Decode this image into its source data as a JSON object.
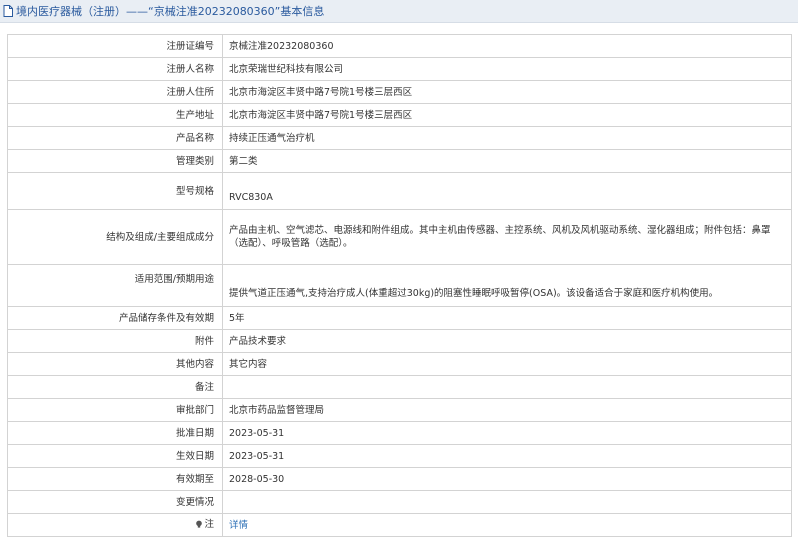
{
  "title": "境内医疗器械（注册）——“京械注准20232080360”基本信息",
  "accent_color": "#2a5a9e",
  "link_color": "#2b6fb6",
  "rows": [
    {
      "label": "注册证编号",
      "value": "京械注准20232080360"
    },
    {
      "label": "注册人名称",
      "value": "北京荣瑞世纪科技有限公司"
    },
    {
      "label": "注册人住所",
      "value": "北京市海淀区丰贤中路7号院1号楼三层西区"
    },
    {
      "label": "生产地址",
      "value": "北京市海淀区丰贤中路7号院1号楼三层西区"
    },
    {
      "label": "产品名称",
      "value": "持续正压通气治疗机"
    },
    {
      "label": "管理类别",
      "value": "第二类"
    },
    {
      "label": "型号规格",
      "value": "RVC830A"
    },
    {
      "label": "结构及组成/主要组成成分",
      "value": "产品由主机、空气滤芯、电源线和附件组成。其中主机由传感器、主控系统、风机及风机驱动系统、湿化器组成；附件包括：鼻罩（选配）、呼吸管路（选配）。"
    },
    {
      "label": "适用范围/预期用途",
      "value": "提供气道正压通气,支持治疗成人(体重超过30kg)的阻塞性睡眠呼吸暂停(OSA)。该设备适合于家庭和医疗机构使用。"
    },
    {
      "label": "产品储存条件及有效期",
      "value": "5年"
    },
    {
      "label": "附件",
      "value": "产品技术要求"
    },
    {
      "label": "其他内容",
      "value": "其它内容"
    },
    {
      "label": "备注",
      "value": ""
    },
    {
      "label": "审批部门",
      "value": "北京市药品监督管理局"
    },
    {
      "label": "批准日期",
      "value": "2023-05-31"
    },
    {
      "label": "生效日期",
      "value": "2023-05-31"
    },
    {
      "label": "有效期至",
      "value": "2028-05-30"
    },
    {
      "label": "变更情况",
      "value": ""
    }
  ],
  "note_row": {
    "label": "注",
    "link": "详情",
    "icon": "bulb-icon"
  }
}
